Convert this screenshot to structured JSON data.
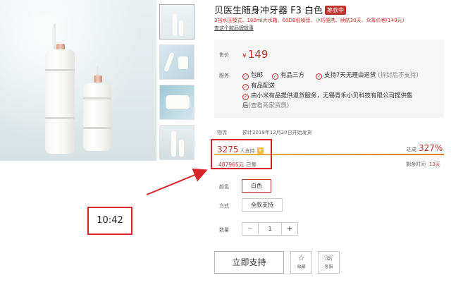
{
  "product": {
    "title": "贝医生随身冲牙器 F3 白色",
    "badge": "筹款中",
    "subtitle": "3挡水压模式、180ml大水箱、60DB低噪音、小巧便携、续航30天、众筹价格(149元)",
    "link": "查这个款品牌故事"
  },
  "price_panel": {
    "price_label": "售价",
    "currency": "¥",
    "price": "149",
    "service_label": "服务",
    "services": [
      "包邮",
      "有品三方",
      "支持7天无理由退货",
      "(拆封后不支持)",
      "有品配送",
      "由小米有品提供退货服务，无锡青禾小贝科技有限公司提供售",
      "后",
      "(查看商家资质)"
    ]
  },
  "logistics": {
    "label": "物流",
    "value": "预计2019年12月20日开始发货"
  },
  "crowdfunding": {
    "supporters": "3275",
    "supporters_unit": "人支持",
    "coin_icon": "coin-icon",
    "reached_label": "达成",
    "reached_pct": "327%",
    "raised": "487965元",
    "raised_unit": "已筹",
    "remaining_label": "剩余时间",
    "remaining_value": "13天",
    "progress": 1.0,
    "accent": "#c0322b"
  },
  "options": {
    "color_label": "颜色",
    "color_value": "白色",
    "mode_label": "方式",
    "mode_value": "全款支持",
    "qty_label": "数量",
    "qty_minus": "−",
    "qty_value": "1",
    "qty_plus": "+"
  },
  "actions": {
    "primary": "立即支持",
    "favorite": "收藏",
    "favorite_icon": "star-icon",
    "service": "客服",
    "service_icon": "headset-icon"
  },
  "annotation": {
    "time": "10:42",
    "color": "#d9262a"
  }
}
